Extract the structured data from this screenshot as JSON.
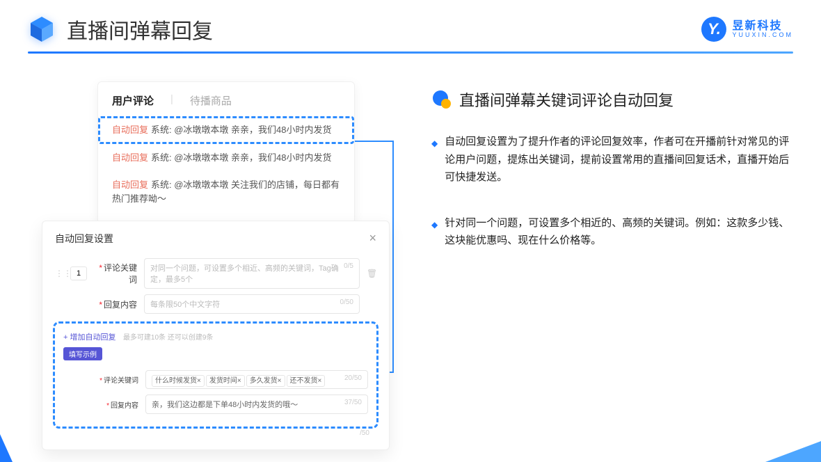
{
  "header": {
    "title": "直播间弹幕回复"
  },
  "brand": {
    "cn": "昱新科技",
    "en": "YUUXIN.COM",
    "mark": "Y."
  },
  "comment_card": {
    "tab_active": "用户评论",
    "tab_inactive": "待播商品",
    "rows": [
      {
        "tag": "自动回复",
        "text": "系统: @冰墩墩本墩 亲亲，我们48小时内发货"
      },
      {
        "tag": "自动回复",
        "text": "系统: @冰墩墩本墩 亲亲，我们48小时内发货"
      },
      {
        "tag": "自动回复",
        "text": "系统: @冰墩墩本墩 关注我们的店铺，每日都有热门推荐呦～"
      }
    ]
  },
  "settings": {
    "title": "自动回复设置",
    "num": "1",
    "kw_label": "评论关键词",
    "kw_placeholder": "对同一个问题，可设置多个相近、高频的关键词，Tag确定，最多5个",
    "kw_counter": "0/5",
    "reply_label": "回复内容",
    "reply_placeholder": "每条限50个中文字符",
    "reply_counter": "0/50",
    "add_link": "+ 增加自动回复",
    "add_hint": "最多可建10条 还可以创建9条",
    "example_badge": "填写示例",
    "ex_kw_label": "评论关键词",
    "ex_tags": [
      "什么时候发货×",
      "发货时间×",
      "多久发货×",
      "还不发货×"
    ],
    "ex_kw_counter": "20/50",
    "ex_reply_label": "回复内容",
    "ex_reply_text": "亲，我们这边都是下单48小时内发货的哦～",
    "ex_reply_counter": "37/50",
    "outer_counter": "/50"
  },
  "feature": {
    "title": "直播间弹幕关键词评论自动回复",
    "bullets": [
      "自动回复设置为了提升作者的评论回复效率，作者可在开播前针对常见的评论用户问题，提炼出关键词，提前设置常用的直播间回复话术，直播开始后可快捷发送。",
      "针对同一个问题，可设置多个相近的、高频的关键词。例如：这款多少钱、这块能优惠吗、现在什么价格等。"
    ]
  }
}
